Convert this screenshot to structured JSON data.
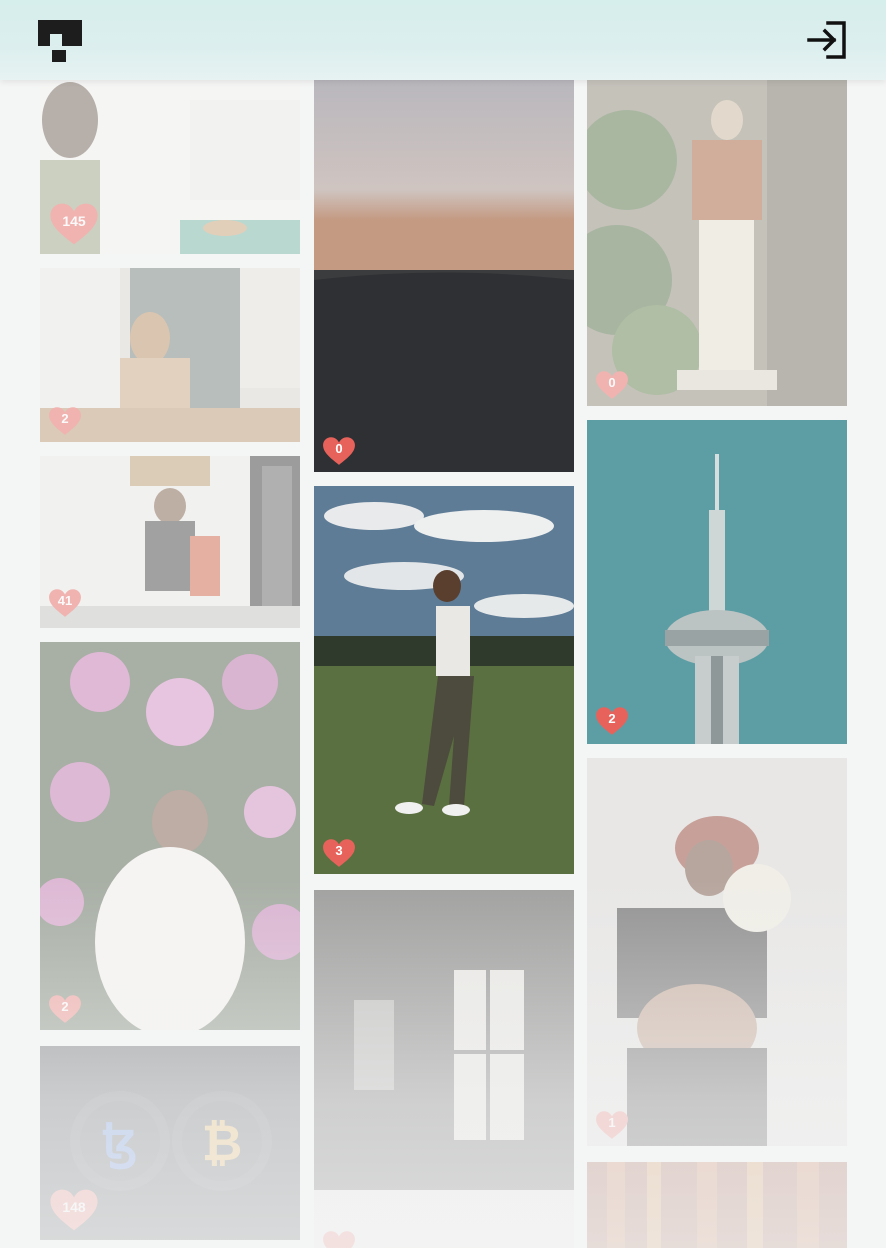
{
  "header": {
    "logo_icon": "pixel-logo-icon",
    "login_icon": "sign-in-icon"
  },
  "gallery": {
    "col1": [
      {
        "likes": "145",
        "subject": "woman-at-cafe-table"
      },
      {
        "likes": "2",
        "subject": "woman-at-window"
      },
      {
        "likes": "41",
        "subject": "woman-with-backpack-corridor"
      },
      {
        "likes": "2",
        "subject": "woman-in-flowers"
      },
      {
        "likes": "148",
        "subject": "crypto-coins-tezos-bitcoin"
      }
    ],
    "col2": [
      {
        "likes": "0",
        "subject": "sunset-valley"
      },
      {
        "likes": "3",
        "subject": "man-in-field"
      },
      {
        "likes": "",
        "subject": "dark-room-window"
      }
    ],
    "col3": [
      {
        "likes": "0",
        "subject": "man-among-plants"
      },
      {
        "likes": "2",
        "subject": "cn-tower"
      },
      {
        "likes": "1",
        "subject": "pregnant-woman-with-flowers"
      },
      {
        "likes": "",
        "subject": "curtain"
      }
    ]
  },
  "colors": {
    "heart": "#e8625c",
    "header": "#d6eeec"
  }
}
